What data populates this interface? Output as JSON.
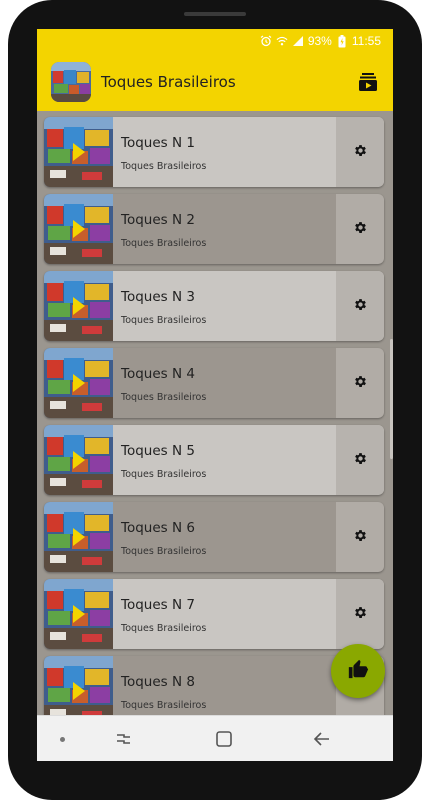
{
  "status": {
    "battery": "93%",
    "time": "11:55",
    "icons": [
      "alarm-icon",
      "wifi-icon",
      "signal-icon",
      "battery-charging-icon"
    ]
  },
  "app": {
    "title": "Toques Brasileiros",
    "action_icon": "playlist-play-icon"
  },
  "items": [
    {
      "title": "Toques N 1",
      "subtitle": "Toques Brasileiros"
    },
    {
      "title": "Toques N 2",
      "subtitle": "Toques Brasileiros"
    },
    {
      "title": "Toques N 3",
      "subtitle": "Toques Brasileiros"
    },
    {
      "title": "Toques N 4",
      "subtitle": "Toques Brasileiros"
    },
    {
      "title": "Toques N 5",
      "subtitle": "Toques Brasileiros"
    },
    {
      "title": "Toques N 6",
      "subtitle": "Toques Brasileiros"
    },
    {
      "title": "Toques N 7",
      "subtitle": "Toques Brasileiros"
    },
    {
      "title": "Toques N 8",
      "subtitle": "Toques Brasileiros"
    }
  ],
  "fab": {
    "icon": "thumbs-up-icon"
  },
  "navbar": {
    "icons": [
      "home-dot-icon",
      "recent-apps-icon",
      "home-icon",
      "back-icon"
    ]
  },
  "colors": {
    "accent": "#f3d400",
    "fab": "#8aa800",
    "card_light": "#c9c6c2",
    "card_dark": "#9c968f"
  }
}
